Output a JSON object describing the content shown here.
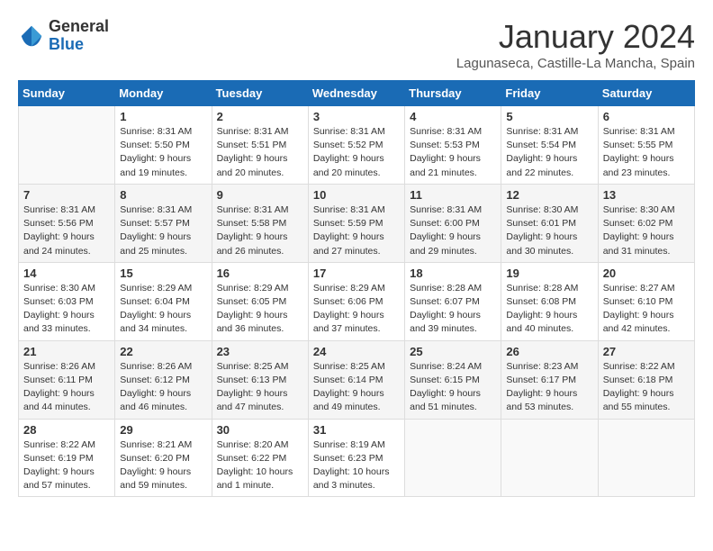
{
  "logo": {
    "general": "General",
    "blue": "Blue"
  },
  "title": "January 2024",
  "location": "Lagunaseca, Castille-La Mancha, Spain",
  "headers": [
    "Sunday",
    "Monday",
    "Tuesday",
    "Wednesday",
    "Thursday",
    "Friday",
    "Saturday"
  ],
  "weeks": [
    [
      {
        "num": "",
        "sunrise": "",
        "sunset": "",
        "daylight": ""
      },
      {
        "num": "1",
        "sunrise": "Sunrise: 8:31 AM",
        "sunset": "Sunset: 5:50 PM",
        "daylight": "Daylight: 9 hours and 19 minutes."
      },
      {
        "num": "2",
        "sunrise": "Sunrise: 8:31 AM",
        "sunset": "Sunset: 5:51 PM",
        "daylight": "Daylight: 9 hours and 20 minutes."
      },
      {
        "num": "3",
        "sunrise": "Sunrise: 8:31 AM",
        "sunset": "Sunset: 5:52 PM",
        "daylight": "Daylight: 9 hours and 20 minutes."
      },
      {
        "num": "4",
        "sunrise": "Sunrise: 8:31 AM",
        "sunset": "Sunset: 5:53 PM",
        "daylight": "Daylight: 9 hours and 21 minutes."
      },
      {
        "num": "5",
        "sunrise": "Sunrise: 8:31 AM",
        "sunset": "Sunset: 5:54 PM",
        "daylight": "Daylight: 9 hours and 22 minutes."
      },
      {
        "num": "6",
        "sunrise": "Sunrise: 8:31 AM",
        "sunset": "Sunset: 5:55 PM",
        "daylight": "Daylight: 9 hours and 23 minutes."
      }
    ],
    [
      {
        "num": "7",
        "sunrise": "Sunrise: 8:31 AM",
        "sunset": "Sunset: 5:56 PM",
        "daylight": "Daylight: 9 hours and 24 minutes."
      },
      {
        "num": "8",
        "sunrise": "Sunrise: 8:31 AM",
        "sunset": "Sunset: 5:57 PM",
        "daylight": "Daylight: 9 hours and 25 minutes."
      },
      {
        "num": "9",
        "sunrise": "Sunrise: 8:31 AM",
        "sunset": "Sunset: 5:58 PM",
        "daylight": "Daylight: 9 hours and 26 minutes."
      },
      {
        "num": "10",
        "sunrise": "Sunrise: 8:31 AM",
        "sunset": "Sunset: 5:59 PM",
        "daylight": "Daylight: 9 hours and 27 minutes."
      },
      {
        "num": "11",
        "sunrise": "Sunrise: 8:31 AM",
        "sunset": "Sunset: 6:00 PM",
        "daylight": "Daylight: 9 hours and 29 minutes."
      },
      {
        "num": "12",
        "sunrise": "Sunrise: 8:30 AM",
        "sunset": "Sunset: 6:01 PM",
        "daylight": "Daylight: 9 hours and 30 minutes."
      },
      {
        "num": "13",
        "sunrise": "Sunrise: 8:30 AM",
        "sunset": "Sunset: 6:02 PM",
        "daylight": "Daylight: 9 hours and 31 minutes."
      }
    ],
    [
      {
        "num": "14",
        "sunrise": "Sunrise: 8:30 AM",
        "sunset": "Sunset: 6:03 PM",
        "daylight": "Daylight: 9 hours and 33 minutes."
      },
      {
        "num": "15",
        "sunrise": "Sunrise: 8:29 AM",
        "sunset": "Sunset: 6:04 PM",
        "daylight": "Daylight: 9 hours and 34 minutes."
      },
      {
        "num": "16",
        "sunrise": "Sunrise: 8:29 AM",
        "sunset": "Sunset: 6:05 PM",
        "daylight": "Daylight: 9 hours and 36 minutes."
      },
      {
        "num": "17",
        "sunrise": "Sunrise: 8:29 AM",
        "sunset": "Sunset: 6:06 PM",
        "daylight": "Daylight: 9 hours and 37 minutes."
      },
      {
        "num": "18",
        "sunrise": "Sunrise: 8:28 AM",
        "sunset": "Sunset: 6:07 PM",
        "daylight": "Daylight: 9 hours and 39 minutes."
      },
      {
        "num": "19",
        "sunrise": "Sunrise: 8:28 AM",
        "sunset": "Sunset: 6:08 PM",
        "daylight": "Daylight: 9 hours and 40 minutes."
      },
      {
        "num": "20",
        "sunrise": "Sunrise: 8:27 AM",
        "sunset": "Sunset: 6:10 PM",
        "daylight": "Daylight: 9 hours and 42 minutes."
      }
    ],
    [
      {
        "num": "21",
        "sunrise": "Sunrise: 8:26 AM",
        "sunset": "Sunset: 6:11 PM",
        "daylight": "Daylight: 9 hours and 44 minutes."
      },
      {
        "num": "22",
        "sunrise": "Sunrise: 8:26 AM",
        "sunset": "Sunset: 6:12 PM",
        "daylight": "Daylight: 9 hours and 46 minutes."
      },
      {
        "num": "23",
        "sunrise": "Sunrise: 8:25 AM",
        "sunset": "Sunset: 6:13 PM",
        "daylight": "Daylight: 9 hours and 47 minutes."
      },
      {
        "num": "24",
        "sunrise": "Sunrise: 8:25 AM",
        "sunset": "Sunset: 6:14 PM",
        "daylight": "Daylight: 9 hours and 49 minutes."
      },
      {
        "num": "25",
        "sunrise": "Sunrise: 8:24 AM",
        "sunset": "Sunset: 6:15 PM",
        "daylight": "Daylight: 9 hours and 51 minutes."
      },
      {
        "num": "26",
        "sunrise": "Sunrise: 8:23 AM",
        "sunset": "Sunset: 6:17 PM",
        "daylight": "Daylight: 9 hours and 53 minutes."
      },
      {
        "num": "27",
        "sunrise": "Sunrise: 8:22 AM",
        "sunset": "Sunset: 6:18 PM",
        "daylight": "Daylight: 9 hours and 55 minutes."
      }
    ],
    [
      {
        "num": "28",
        "sunrise": "Sunrise: 8:22 AM",
        "sunset": "Sunset: 6:19 PM",
        "daylight": "Daylight: 9 hours and 57 minutes."
      },
      {
        "num": "29",
        "sunrise": "Sunrise: 8:21 AM",
        "sunset": "Sunset: 6:20 PM",
        "daylight": "Daylight: 9 hours and 59 minutes."
      },
      {
        "num": "30",
        "sunrise": "Sunrise: 8:20 AM",
        "sunset": "Sunset: 6:22 PM",
        "daylight": "Daylight: 10 hours and 1 minute."
      },
      {
        "num": "31",
        "sunrise": "Sunrise: 8:19 AM",
        "sunset": "Sunset: 6:23 PM",
        "daylight": "Daylight: 10 hours and 3 minutes."
      },
      {
        "num": "",
        "sunrise": "",
        "sunset": "",
        "daylight": ""
      },
      {
        "num": "",
        "sunrise": "",
        "sunset": "",
        "daylight": ""
      },
      {
        "num": "",
        "sunrise": "",
        "sunset": "",
        "daylight": ""
      }
    ]
  ]
}
